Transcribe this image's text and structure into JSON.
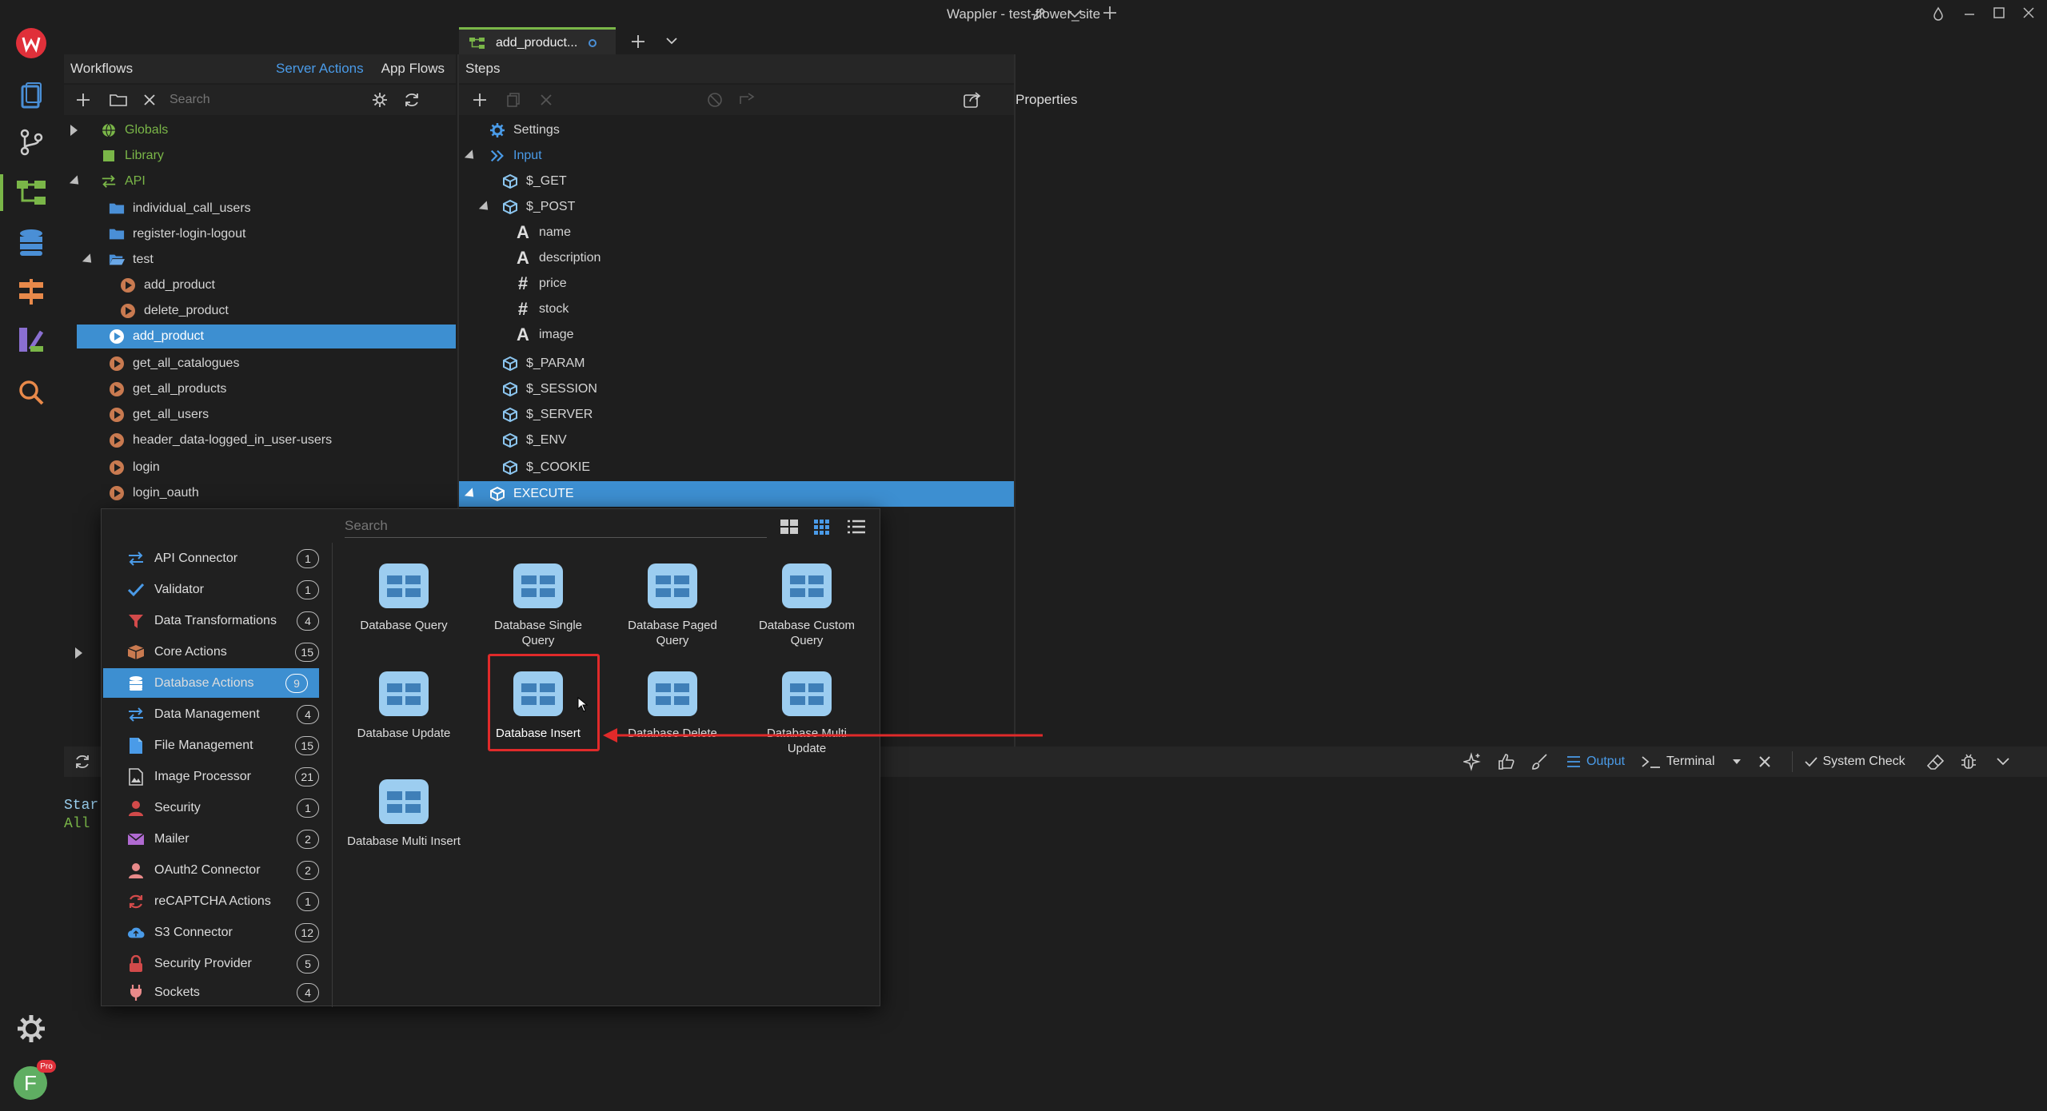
{
  "window": {
    "title": "Wappler - test-flower_site"
  },
  "tab": {
    "label": "add_product..."
  },
  "workflows": {
    "title": "Workflows",
    "tab_server": "Server Actions",
    "tab_app": "App Flows",
    "search_placeholder": "Search",
    "tree": [
      {
        "label": "Globals"
      },
      {
        "label": "Library"
      },
      {
        "label": "API"
      },
      {
        "label": "individual_call_users"
      },
      {
        "label": "register-login-logout"
      },
      {
        "label": "test"
      },
      {
        "label": "add_product"
      },
      {
        "label": "delete_product"
      },
      {
        "label": "add_product"
      },
      {
        "label": "get_all_catalogues"
      },
      {
        "label": "get_all_products"
      },
      {
        "label": "get_all_users"
      },
      {
        "label": "header_data-logged_in_user-users"
      },
      {
        "label": "login"
      },
      {
        "label": "login_oauth"
      }
    ]
  },
  "steps": {
    "title": "Steps",
    "tree": [
      {
        "label": "Settings"
      },
      {
        "label": "Input"
      },
      {
        "label": "$_GET"
      },
      {
        "label": "$_POST"
      },
      {
        "label": "name"
      },
      {
        "label": "description"
      },
      {
        "label": "price"
      },
      {
        "label": "stock"
      },
      {
        "label": "image"
      },
      {
        "label": "$_PARAM"
      },
      {
        "label": "$_SESSION"
      },
      {
        "label": "$_SERVER"
      },
      {
        "label": "$_ENV"
      },
      {
        "label": "$_COOKIE"
      },
      {
        "label": "EXECUTE"
      }
    ]
  },
  "properties": {
    "title": "Properties"
  },
  "picker": {
    "search_placeholder": "Search",
    "categories": [
      {
        "label": "API Connector",
        "count": "1"
      },
      {
        "label": "Validator",
        "count": "1"
      },
      {
        "label": "Data Transformations",
        "count": "4"
      },
      {
        "label": "Core Actions",
        "count": "15"
      },
      {
        "label": "Database Actions",
        "count": "9"
      },
      {
        "label": "Data Management",
        "count": "4"
      },
      {
        "label": "File Management",
        "count": "15"
      },
      {
        "label": "Image Processor",
        "count": "21"
      },
      {
        "label": "Security",
        "count": "1"
      },
      {
        "label": "Mailer",
        "count": "2"
      },
      {
        "label": "OAuth2 Connector",
        "count": "2"
      },
      {
        "label": "reCAPTCHA Actions",
        "count": "1"
      },
      {
        "label": "S3 Connector",
        "count": "12"
      },
      {
        "label": "Security Provider",
        "count": "5"
      },
      {
        "label": "Sockets",
        "count": "4"
      }
    ],
    "actions": [
      {
        "l1": "Database Query",
        "l2": ""
      },
      {
        "l1": "Database Single",
        "l2": "Query"
      },
      {
        "l1": "Database Paged",
        "l2": "Query"
      },
      {
        "l1": "Database Custom",
        "l2": "Query"
      },
      {
        "l1": "Database Update",
        "l2": ""
      },
      {
        "l1": "Database Insert",
        "l2": ""
      },
      {
        "l1": "Database Delete",
        "l2": ""
      },
      {
        "l1": "Database Multi",
        "l2": "Update"
      },
      {
        "l1": "Database Multi Insert",
        "l2": ""
      }
    ]
  },
  "bottom": {
    "output": "Output",
    "terminal": "Terminal",
    "system_check": "System Check",
    "console_line1": "Star",
    "console_line2": "All"
  },
  "user": {
    "initial": "F",
    "badge": "Pro"
  },
  "colors": {
    "accent": "#3d8fd1",
    "highlight": "#e02a2a",
    "tree_green": "#7ab648"
  }
}
